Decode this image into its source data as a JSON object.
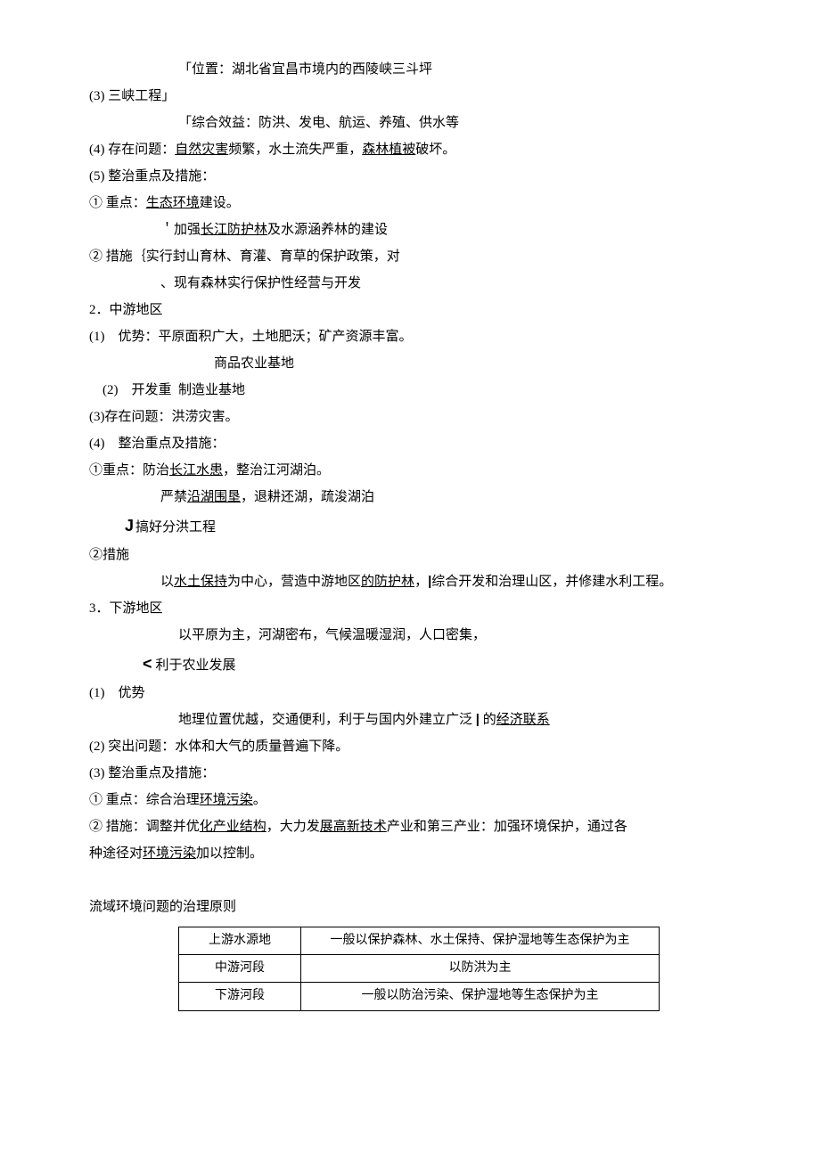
{
  "s3_l1": "「位置：湖北省宜昌市境内的西陵峡三斗坪",
  "s3_l2": "(3) 三峡工程」",
  "s3_l3": "「综合效益：防洪、发电、航运、养殖、供水等",
  "s4_p1": "(4) 存在问题：",
  "s4_u1": "自然灾害",
  "s4_p2": "频繁，水土流失严重，",
  "s4_u2": "森林植被",
  "s4_p3": "破坏。",
  "s5_l1": "(5) 整治重点及措施：",
  "s5_1a": "① 重点：",
  "s5_1u": "生态环境",
  "s5_1b": "建设。",
  "s5_2a_pre": "＇加强",
  "s5_2a_u": "长江防护林",
  "s5_2a_post": "及水源涵养林的建设",
  "s5_2b": "② 措施｛实行封山育林、育灌、育草的保护政策，对",
  "s5_2c": "、现有森林实行保护性经营与开发",
  "mid_h": "2．中游地区",
  "mid_1": "(1)　优势：平原面积广大，土地肥沃；矿产资源丰富。",
  "mid_1b": "商品农业基地",
  "mid_2a": "　(2)　开发重",
  "mid_2b": "制造业基地",
  "mid_3": "(3)存在问题：洪涝灾害。",
  "mid_4": "(4)　整治重点及措施：",
  "mid_4_1a": "①重点：防治",
  "mid_4_1u": "长江水患",
  "mid_4_1b": "，整治江河湖泊。",
  "mid_4_m1a": "严禁",
  "mid_4_m1u": "沿湖围垦",
  "mid_4_m1b": "，退耕还湖，疏浚湖泊",
  "mid_4_m2": "搞好分洪工程",
  "mid_4_m_label": "②措施",
  "mid_4_m3a": "以",
  "mid_4_m3u1": "水土保持",
  "mid_4_m3b": "为中心，营造中游地区",
  "mid_4_m3u2": "的防护林",
  "mid_4_m3c": "，",
  "mid_4_m3d": "综合开发和治理山区，并修建水利工程。",
  "down_h": "3．下游地区",
  "down_a1": "以平原为主，河湖密布，气候温暖湿润，人口密集，",
  "down_a2": "利于农业发展",
  "down_1": "(1)　优势",
  "down_a3a": "地理位置优越，交通便利，利于与国内外建立广泛 ",
  "down_a3b": " 的",
  "down_a3u": "经济联系",
  "down_2": "(2) 突出问题：水体和大气的质量普遍下降。",
  "down_3": "(3) 整治重点及措施：",
  "down_3_1a": "① 重点：综合治理",
  "down_3_1u": "环境污染",
  "down_3_1b": "。",
  "down_3_2a": "② 措施：调整并优",
  "down_3_2u1": "化产业结构",
  "down_3_2b": "，大力发",
  "down_3_2u2": "展高新技术",
  "down_3_2c": "产业和第三产业：加强环境保护，通过各",
  "down_3_2d": "种途径对",
  "down_3_2u3": "环境污染",
  "down_3_2e": "加以控制。",
  "principle_h": "流域环境问题的治理原则",
  "table": {
    "r1c1": "上游水源地",
    "r1c2": "一般以保护森林、水土保持、保护湿地等生态保护为主",
    "r2c1": "中游河段",
    "r2c2": "以防洪为主",
    "r3c1": "下游河段",
    "r3c2": "一般以防治污染、保护湿地等生态保护为主"
  }
}
